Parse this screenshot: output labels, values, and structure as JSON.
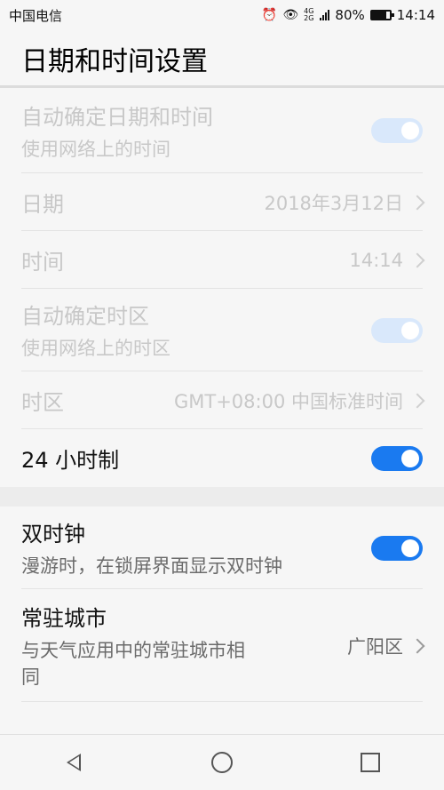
{
  "statusbar": {
    "carrier": "中国电信",
    "icons": [
      "alarm-icon",
      "eye-icon",
      "signal-icon",
      "battery-icon"
    ],
    "net_top": "4G",
    "net_bottom": "2G",
    "battery": "80%",
    "battery_level": 0.8,
    "time": "14:14"
  },
  "header": {
    "title": "日期和时间设置"
  },
  "items": [
    {
      "title": "自动确定日期和时间",
      "subtitle": "使用网络上的时间"
    },
    {
      "title": "日期",
      "value": "2018年3月12日"
    },
    {
      "title": "时间",
      "value": "14:14"
    },
    {
      "title": "自动确定时区",
      "subtitle": "使用网络上的时区"
    },
    {
      "title": "时区",
      "value": "GMT+08:00 中国标准时间"
    },
    {
      "title": "24 小时制"
    }
  ],
  "items2": [
    {
      "title": "双时钟",
      "subtitle": "漫游时，在锁屏界面显示双时钟"
    },
    {
      "title": "常驻城市",
      "subtitle": "与天气应用中的常驻城市相同",
      "value": "广阳区"
    }
  ],
  "navbar": {
    "icons": [
      "back-icon",
      "home-icon",
      "recent-apps-icon"
    ]
  },
  "colors": {
    "accent": "#1a7af0",
    "toggle_disabled": "#d9e8fb",
    "disabled_text": "#c8c8c8"
  }
}
